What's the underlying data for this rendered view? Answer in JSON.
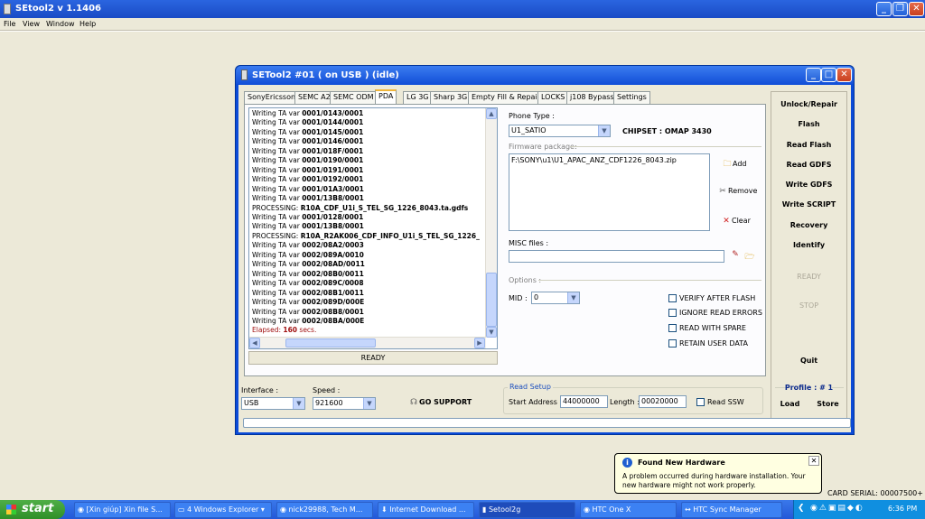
{
  "app_title": "SEtool2 v 1.1406",
  "menu": [
    "File",
    "View",
    "Window",
    "Help"
  ],
  "child_title": "SETool2 #01 ( on USB ) (idle)",
  "tabs": [
    "SonyEricsson",
    "SEMC A2",
    "SEMC ODM",
    "PDA",
    "LG 3G",
    "Sharp 3G",
    "Empty Fill & Repair",
    "LOCKS",
    "j108 Bypass",
    "Settings"
  ],
  "active_tab": "PDA",
  "log": [
    {
      "p": "Writing TA var ",
      "b": "0001/0143/0001"
    },
    {
      "p": "Writing TA var ",
      "b": "0001/0144/0001"
    },
    {
      "p": "Writing TA var ",
      "b": "0001/0145/0001"
    },
    {
      "p": "Writing TA var ",
      "b": "0001/0146/0001"
    },
    {
      "p": "Writing TA var ",
      "b": "0001/018F/0001"
    },
    {
      "p": "Writing TA var ",
      "b": "0001/0190/0001"
    },
    {
      "p": "Writing TA var ",
      "b": "0001/0191/0001"
    },
    {
      "p": "Writing TA var ",
      "b": "0001/0192/0001"
    },
    {
      "p": "Writing TA var ",
      "b": "0001/01A3/0001"
    },
    {
      "p": "Writing TA var ",
      "b": "0001/13B8/0001"
    },
    {
      "p": "PROCESSING: ",
      "b": "R10A_CDF_U1i_S_TEL_SG_1226_8043.ta.gdfs"
    },
    {
      "p": "Writing TA var ",
      "b": "0001/0128/0001"
    },
    {
      "p": "Writing TA var ",
      "b": "0001/13B8/0001"
    },
    {
      "p": "PROCESSING: ",
      "b": "R10A_R2AK006_CDF_INFO_U1i_S_TEL_SG_1226_"
    },
    {
      "p": "Writing TA var ",
      "b": "0002/08A2/0003"
    },
    {
      "p": "Writing TA var ",
      "b": "0002/089A/0010"
    },
    {
      "p": "Writing TA var ",
      "b": "0002/08AD/0011"
    },
    {
      "p": "Writing TA var ",
      "b": "0002/08B0/0011"
    },
    {
      "p": "Writing TA var ",
      "b": "0002/089C/0008"
    },
    {
      "p": "Writing TA var ",
      "b": "0002/08B1/0011"
    },
    {
      "p": "Writing TA var ",
      "b": "0002/089D/000E"
    },
    {
      "p": "Writing TA var ",
      "b": "0002/08B8/0001"
    },
    {
      "p": "Writing TA var ",
      "b": "0002/08BA/000E"
    }
  ],
  "elapsed": {
    "prefix": "Elapsed: ",
    "value": "160",
    "suffix": " secs."
  },
  "status_ready": "READY",
  "phone_type_label": "Phone Type :",
  "phone_type_value": "U1_SATIO",
  "chipset": "CHIPSET : OMAP 3430",
  "firmware_label": "Firmware package:",
  "firmware_value": "F:\\SONY\\u1\\U1_APAC_ANZ_CDF1226_8043.zip",
  "btn_add": "Add",
  "btn_remove": "Remove",
  "btn_clear": "Clear",
  "misc_label": "MISC files :",
  "options_label": "Options :",
  "mid_label": "MID :",
  "mid_value": "0",
  "checks": [
    "VERIFY AFTER FLASH",
    "IGNORE READ ERRORS",
    "READ WITH SPARE",
    "RETAIN USER DATA"
  ],
  "right_buttons": [
    "Unlock/Repair",
    "Flash",
    "Read Flash",
    "Read GDFS",
    "Write GDFS",
    "Write SCRIPT",
    "Recovery",
    "Identify",
    "READY",
    "STOP",
    "Quit"
  ],
  "profile_label": "Profile :",
  "profile_value": "# 1",
  "btn_load": "Load",
  "btn_store": "Store",
  "interface_label": "Interface :",
  "interface_value": "USB",
  "speed_label": "Speed :",
  "speed_value": "921600",
  "go_support": "GO SUPPORT",
  "read_setup": "Read Setup",
  "start_addr_label": "Start Address :",
  "start_addr_value": "44000000",
  "length_label": "Length :",
  "length_value": "00020000",
  "read_ssw": "Read SSW",
  "balloon_title": "Found New Hardware",
  "balloon_text": "A problem occurred during hardware installation. Your new hardware might not work properly.",
  "card_serial": "CARD SERIAL: 00007500+",
  "start_label": "start",
  "taskbar": [
    "[Xin giúp] Xin file S...",
    "4 Windows Explorer",
    "nick29988, Tech M...",
    "Internet Download ...",
    "Setool2g",
    "HTC One X",
    "HTC Sync Manager"
  ],
  "clock": "6:36 PM"
}
